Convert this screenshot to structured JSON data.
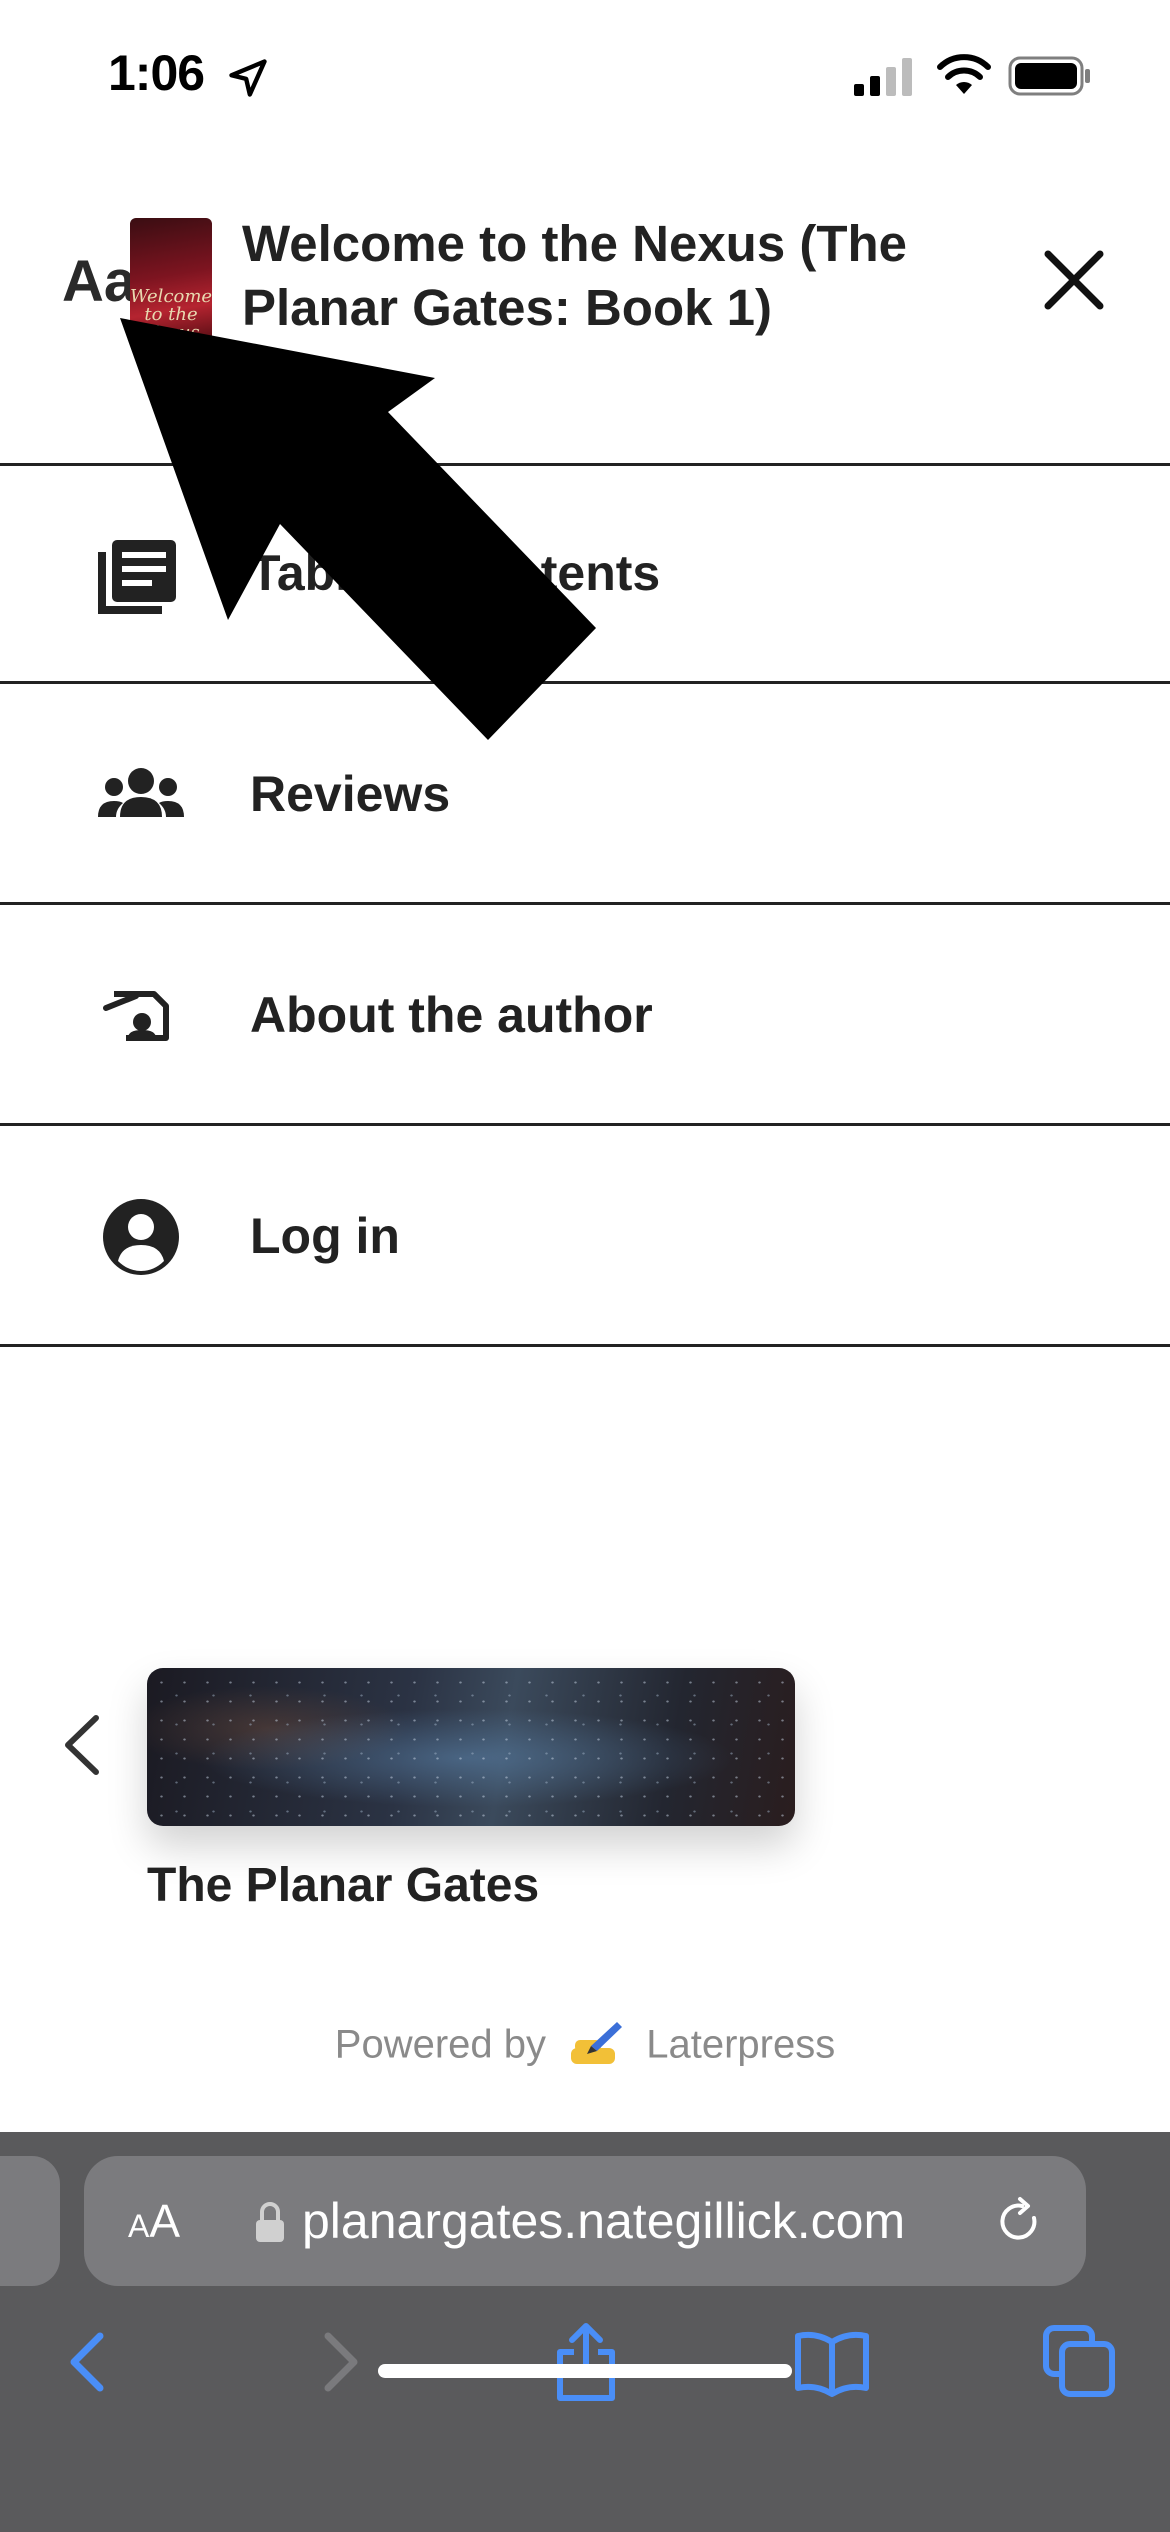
{
  "status_bar": {
    "time": "1:06"
  },
  "header": {
    "font_toggle": "Aa",
    "cover_text": "Welcome to the Nexus",
    "book_title": "Welcome to the Nexus (The Planar Gates: Book 1)"
  },
  "menu": {
    "items": [
      {
        "label": "Table of contents",
        "icon": "book-list-icon"
      },
      {
        "label": "Reviews",
        "icon": "people-icon"
      },
      {
        "label": "About the author",
        "icon": "author-icon"
      },
      {
        "label": "Log in",
        "icon": "account-icon"
      }
    ]
  },
  "series": {
    "name": "The Planar Gates"
  },
  "footer": {
    "powered_prefix": "Powered by",
    "brand": "Laterpress"
  },
  "browser": {
    "reader_label_small": "A",
    "reader_label_large": "A",
    "url": "planargates.nategillick.com"
  },
  "colors": {
    "browser_bar": "#5a5a5c",
    "toolbar_accent": "#4a8ef7",
    "text": "#222222"
  }
}
